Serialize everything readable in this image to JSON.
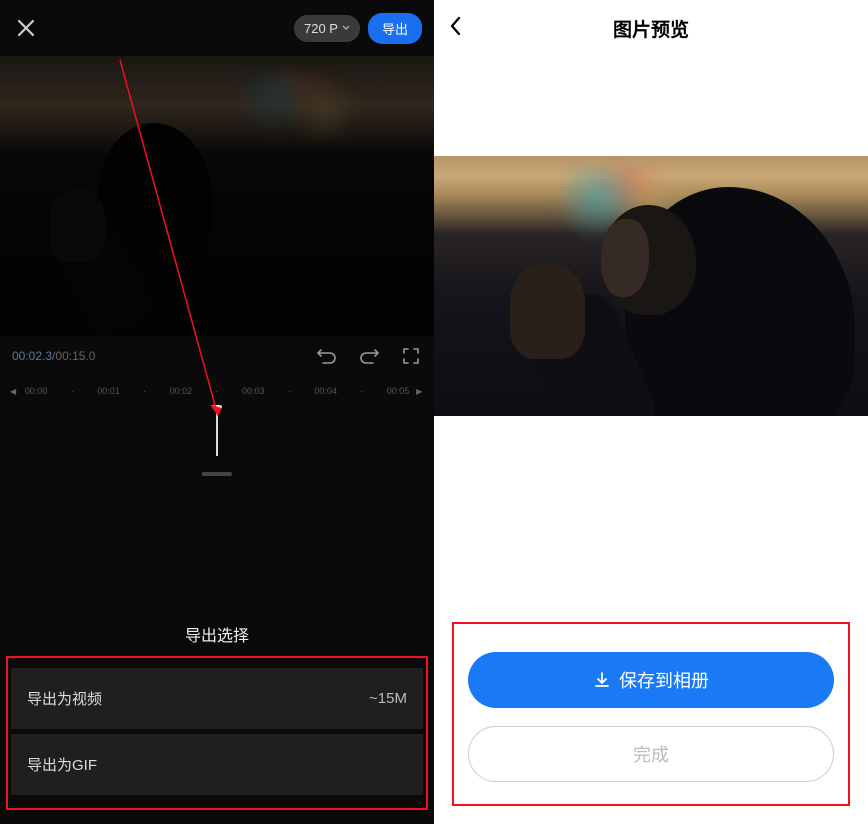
{
  "left": {
    "resolution_label": "720 P",
    "export_label": "导出",
    "time_current": "00:02.3",
    "time_total": "00:15.0",
    "ruler": [
      "00:00",
      "00:01",
      "00:02",
      "00:03",
      "00:04",
      "00:05"
    ],
    "export_title": "导出选择",
    "option_video_label": "导出为视频",
    "option_video_size": "~15M",
    "option_gif_label": "导出为GIF"
  },
  "right": {
    "title": "图片预览",
    "save_label": "保存到相册",
    "done_label": "完成"
  }
}
